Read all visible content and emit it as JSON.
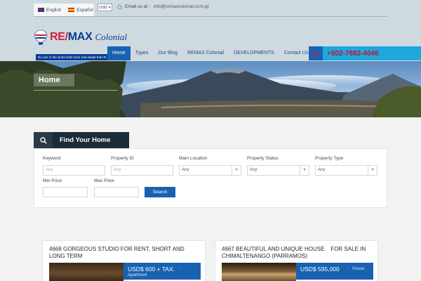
{
  "topbar": {
    "lang_english": "English",
    "lang_spanish": "Español",
    "currency": "USD",
    "email_label": "Email us at :",
    "email_address": "info@remaxcolonial.com.gt"
  },
  "logo": {
    "brand_red": "RE/",
    "brand_blue": "MAX",
    "brand_sub": "Colonial",
    "tagline": "No one in the world sells more real estate than R"
  },
  "nav": {
    "items": [
      "Home",
      "Types",
      "Our Blog",
      "REMAX Colonial",
      "DEVELOPMENTS",
      "Contact Us"
    ],
    "active_index": 0
  },
  "phone": "+502-7882-4046",
  "hero": {
    "title": "Home"
  },
  "search": {
    "tab_label": "Find Your Home",
    "keyword_label": "Keyword",
    "keyword_placeholder": "Any",
    "property_id_label": "Property ID",
    "property_id_placeholder": "Any",
    "main_location_label": "Main Location",
    "main_location_value": "Any",
    "property_status_label": "Property Status",
    "property_status_value": "Any",
    "property_type_label": "Property Type",
    "property_type_value": "Any",
    "min_price_label": "Min Price",
    "max_price_label": "Max Price",
    "button_label": "Search"
  },
  "listings": [
    {
      "title_line1": "4668 GORGEOUS STUDIO FOR RENT, SHORT AND",
      "title_line2": "LONG TERM",
      "price": "USD$ 600 + TAX.",
      "sep": "-",
      "type": "Apartment"
    },
    {
      "title_line1": "4667 BEAUTIFUL AND UNIQUE HOUSE    FOR SALE IN",
      "title_line2": "CHIMALTENANGO (PARRAMOS)",
      "price": "USD$ 595,000",
      "sep": "-",
      "type": "House"
    }
  ],
  "colors": {
    "accent": "#1862b1",
    "phone_bar": "#1ea8de",
    "brand_red": "#d31f33",
    "brand_blue": "#0a3d91",
    "search_tab": "#1b2b37"
  }
}
